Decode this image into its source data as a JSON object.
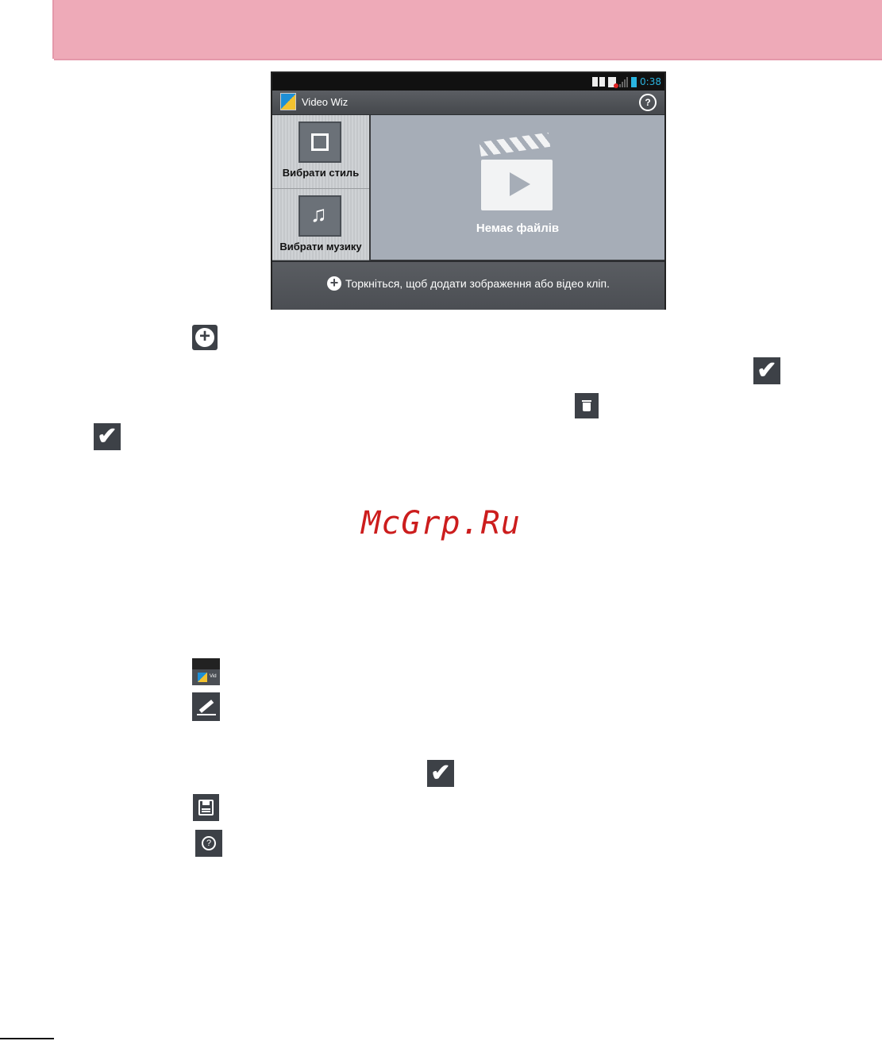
{
  "colors": {
    "header_band": "#eeaab8",
    "status_accent": "#2ab4e0",
    "watermark": "#cc1d1d",
    "icon_background": "#3d4147"
  },
  "phone": {
    "status_bar": {
      "time": "0:38"
    },
    "app_bar": {
      "title": "Video Wiz",
      "help_glyph": "?"
    },
    "sidebar": {
      "style_button": {
        "label": "Вибрати стиль",
        "icon": "frame-icon"
      },
      "music_button": {
        "label": "Вибрати музику",
        "icon": "music-note-icon",
        "glyph": "♫"
      }
    },
    "preview": {
      "empty_text": "Немає файлів",
      "icon": "clapperboard-icon"
    },
    "add_bar": {
      "plus_glyph": "+",
      "text": "Торкніться, щоб додати зображення або відео кліп."
    }
  },
  "inline_icons": {
    "check_glyph": "✔",
    "help_glyph": "?",
    "mini_app_text": "Vid"
  },
  "watermark": "McGrp.Ru"
}
